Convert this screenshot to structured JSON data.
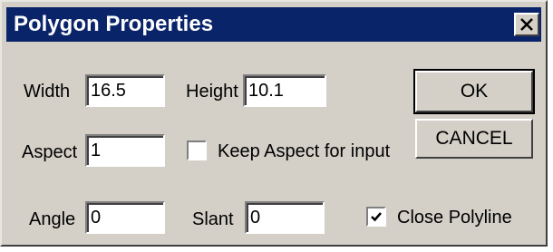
{
  "dialog": {
    "title": "Polygon Properties",
    "close_icon": "close-icon"
  },
  "fields": {
    "width": {
      "label": "Width",
      "value": "16.5"
    },
    "height": {
      "label": "Height",
      "value": "10.1"
    },
    "aspect": {
      "label": "Aspect",
      "value": "1"
    },
    "angle": {
      "label": "Angle",
      "value": "0"
    },
    "slant": {
      "label": "Slant",
      "value": "0"
    }
  },
  "checkboxes": {
    "keep_aspect": {
      "label": "Keep Aspect for input",
      "checked": false
    },
    "close_polyline": {
      "label": "Close Polyline",
      "checked": true
    }
  },
  "buttons": {
    "ok": "OK",
    "cancel": "CANCEL"
  },
  "colors": {
    "titlebar": "#0a246a",
    "face": "#d4d0c8"
  }
}
